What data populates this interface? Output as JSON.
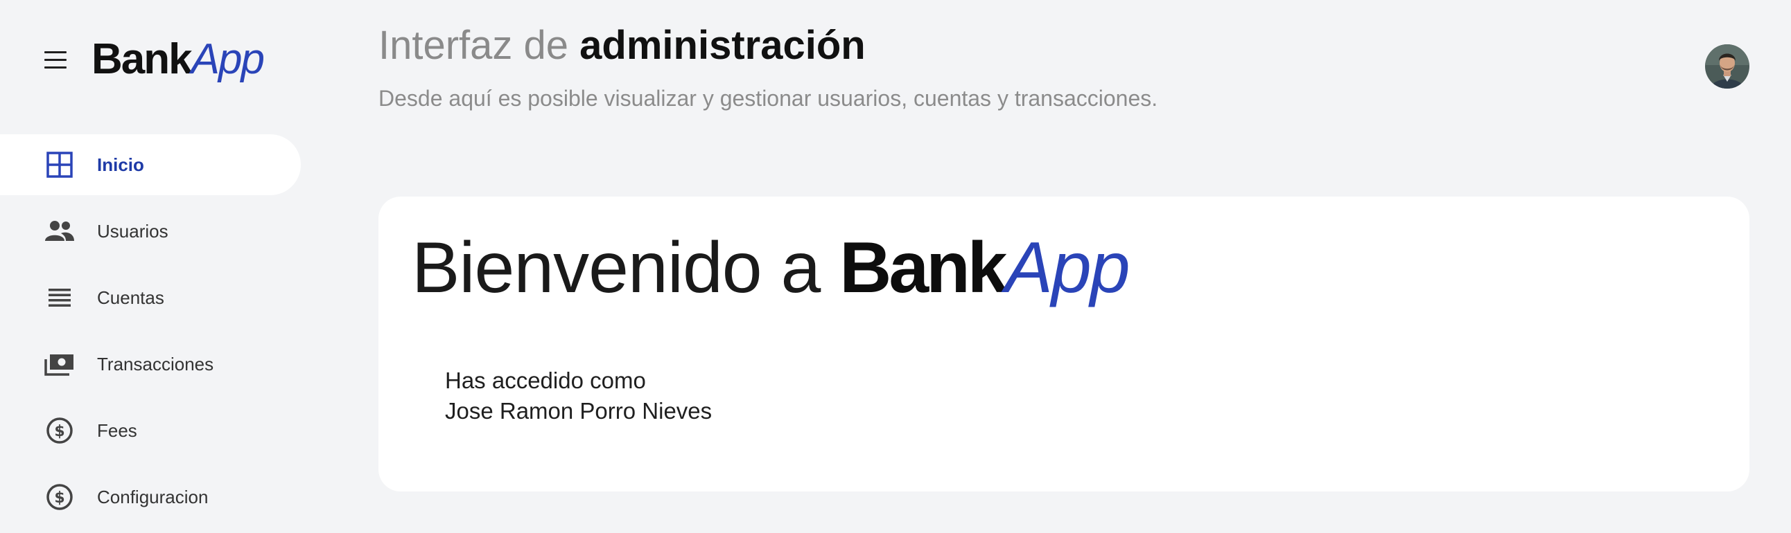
{
  "brand": {
    "bank": "Bank",
    "app": "App",
    "color": "#2a44b8"
  },
  "sidebar": {
    "items": [
      {
        "label": "Inicio",
        "icon": "grid-icon",
        "active": true
      },
      {
        "label": "Usuarios",
        "icon": "people-icon"
      },
      {
        "label": "Cuentas",
        "icon": "list-icon"
      },
      {
        "label": "Transacciones",
        "icon": "money-icon"
      },
      {
        "label": "Fees",
        "icon": "dollar-circle-icon"
      },
      {
        "label": "Configuracion",
        "icon": "dollar-circle-icon"
      }
    ]
  },
  "header": {
    "title_light": "Interfaz de ",
    "title_bold": "administración",
    "subtitle": "Desde aquí es posible visualizar y gestionar usuarios, cuentas y transacciones."
  },
  "card": {
    "welcome_prefix": "Bienvenido a ",
    "brand_bank": "Bank",
    "brand_app": "App",
    "access_line1": "Has accedido como",
    "user_name": "Jose Ramon Porro Nieves"
  },
  "colors": {
    "background": "#f3f4f6",
    "accent": "#2a44b8",
    "active_text": "#1f3ba7"
  }
}
